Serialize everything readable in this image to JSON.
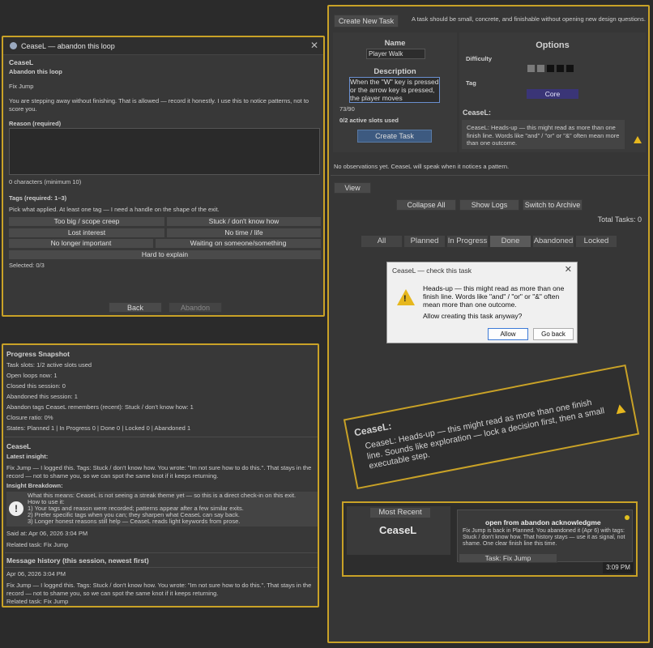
{
  "abandon_dialog": {
    "title": "CeaseL — abandon this loop",
    "heading": "CeaseL",
    "subheading": "Abandon this loop",
    "task_name": "Fix Jump",
    "intro": "You are stepping away without finishing. That is allowed — record it honestly. I use this to notice patterns, not to score you.",
    "reason_label": "Reason (required)",
    "reason_value": "",
    "char_count": "0 characters (minimum 10)",
    "tags_label": "Tags (required: 1–3)",
    "tags_hint": "Pick what applied. At least one tag — I need a handle on the shape of the exit.",
    "tags": [
      "Too big / scope creep",
      "Stuck / don't know how",
      "Lost interest",
      "No time / life",
      "No longer important",
      "Waiting on someone/something",
      "Hard to explain"
    ],
    "selected": "Selected: 0/3",
    "back_label": "Back",
    "abandon_label": "Abandon"
  },
  "progress": {
    "title": "Progress Snapshot",
    "task_slots": "Task slots: 1/2 active slots used",
    "open_loops": "Open loops now: 1",
    "closed": "Closed this session: 0",
    "abandoned": "Abandoned this session: 1",
    "abandon_tags": "Abandon tags CeaseL remembers (recent): Stuck / don't know how: 1",
    "closure": "Closure ratio: 0%",
    "states": "States: Planned 1 | In Progress 0 | Done 0 | Locked 0 | Abandoned 1",
    "ceasel_heading": "CeaseL",
    "latest_label": "Latest insight:",
    "latest_text": "Fix Jump — I logged this. Tags: Stuck / don't know how. You wrote: \"Im not sure how to do this.\". That stays in the record — not to shame you, so we can spot the same knot if it keeps returning.",
    "breakdown_label": "Insight Breakdown:",
    "breakdown_lines": [
      "What this means: CeaseL is not seeing a streak theme yet — so this is a direct check-in on this exit.",
      "How to use it:",
      "1) Your tags and reason were recorded; patterns appear after a few similar exits.",
      "2) Prefer specific tags when you can; they sharpen what CeaseL can say back.",
      "3) Longer honest reasons still help — CeaseL reads light keywords from prose."
    ],
    "said_at": "Said at: Apr 06, 2026 3:04 PM",
    "related": "Related task: Fix Jump",
    "history_title": "Message history (this session, newest first)",
    "history_date": "Apr 06, 2026 3:04 PM",
    "history_text": "Fix Jump — I logged this. Tags: Stuck / don't know how. You wrote: \"Im not sure how to do this.\". That stays in the record — not to shame you, so we can spot the same knot if it keeps returning.",
    "history_related": "Related task: Fix Jump"
  },
  "create": {
    "button": "Create New Task",
    "hint": "A task should be small, concrete, and finishable without opening new design questions.",
    "name_label": "Name",
    "name_value": "Player Walk",
    "desc_label": "Description",
    "desc_value": "When the \"W\" key is pressed or the arrow key is pressed, the player moves",
    "char_count": "73/90",
    "slots": "0/2 active slots used",
    "create_label": "Create Task",
    "options_title": "Options",
    "difficulty_label": "Difficulty",
    "tag_label": "Tag",
    "tag_value": "Core",
    "ceasel_label": "CeaseL:",
    "ceasel_text": "CeaseL: Heads-up — this might read as more than one finish line. Words like \"and\" / \"or\" or \"&\" often mean more than one outcome.",
    "observations": "No observations yet. CeaseL will speak when it notices a pattern."
  },
  "view": {
    "view_label": "View",
    "collapse": "Collapse All",
    "logs": "Show Logs",
    "archive": "Switch to Archive",
    "total": "Total Tasks: 0",
    "tabs": [
      "All",
      "Planned",
      "In Progress",
      "Done",
      "Abandoned",
      "Locked"
    ],
    "active_tab": "Done"
  },
  "check": {
    "title": "CeaseL — check this task",
    "message": "Heads-up — this might read as more than one finish line. Words like \"and\" / \"or\" or \"&\" often mean more than one outcome.",
    "question": "Allow creating this task anyway?",
    "allow": "Allow",
    "go_back": "Go back"
  },
  "tilted": {
    "heading": "CeaseL:",
    "text": "CeaseL: Heads-up — this might read as more than one finish line. Sounds like exploration — lock a decision first, then a small executable step."
  },
  "recent": {
    "label": "Most Recent",
    "name": "CeaseL",
    "title": "open from abandon acknowledgme",
    "text": "Fix Jump is back in Planned. You abandoned it (Apr 6) with tags: Stuck / don't know how. That history stays — use it as signal, not shame. One clear finish line this time.",
    "task": "Task: Fix Jump",
    "time": "3:09 PM"
  },
  "colors": {
    "gold": "#c9a227",
    "accent_blue": "#3d5a80",
    "tag_purple": "#3a3577",
    "warning": "#e6b71e"
  }
}
